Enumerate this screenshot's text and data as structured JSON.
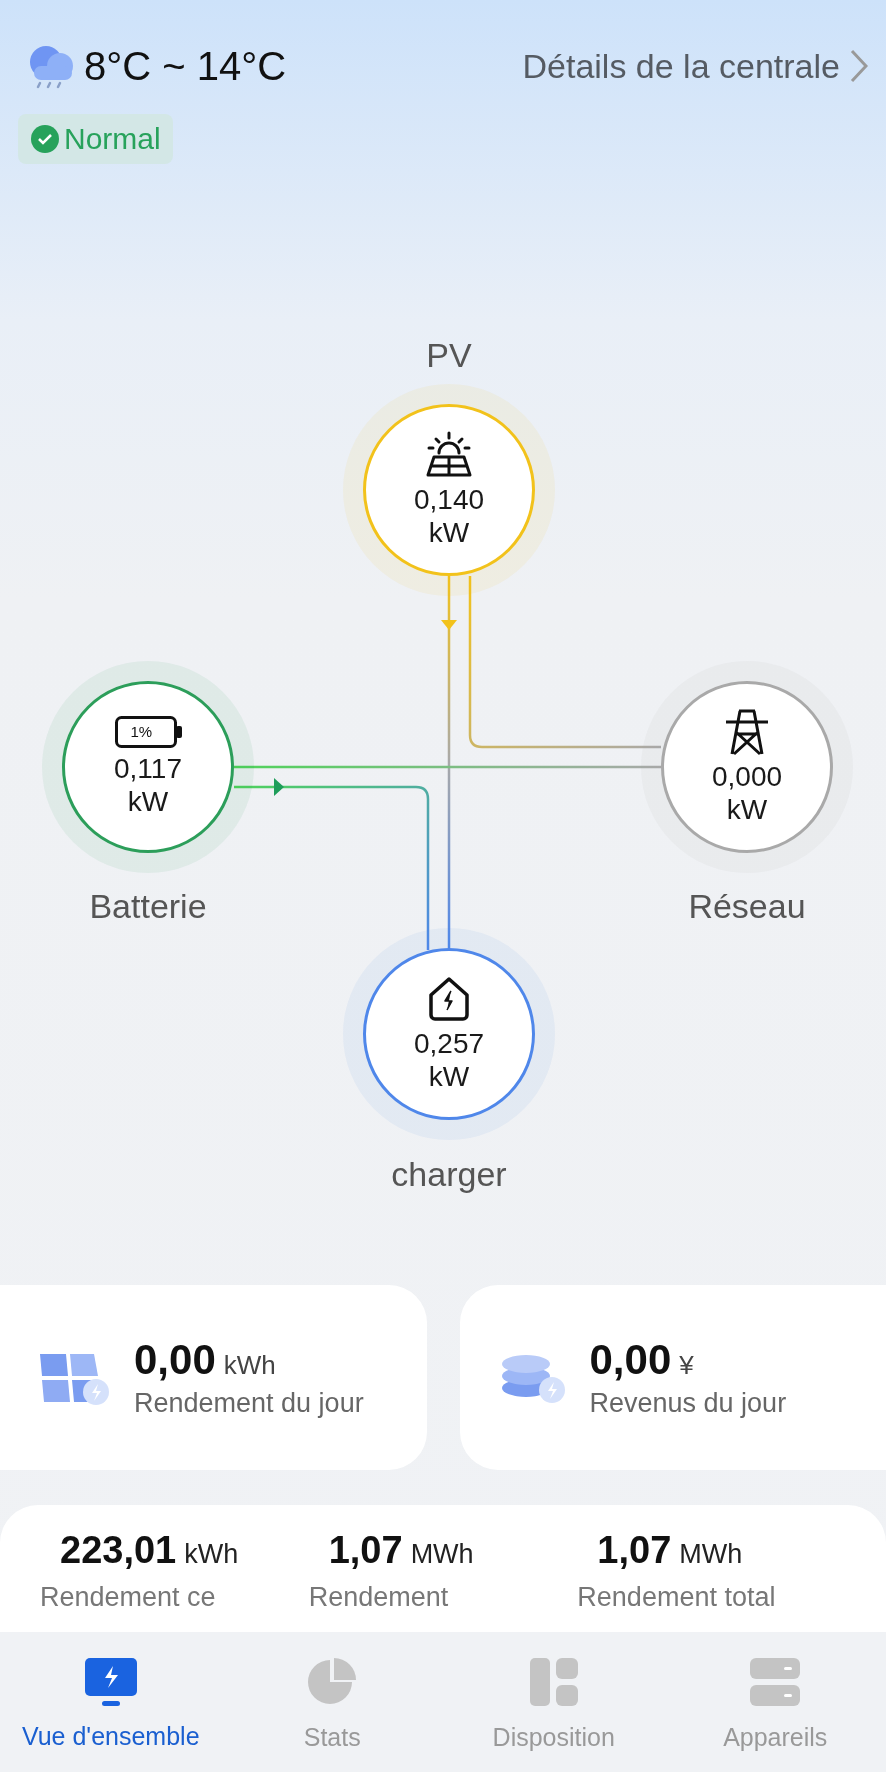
{
  "header": {
    "temperature": "8°C ~ 14°C",
    "details_link": "Détails de la centrale"
  },
  "status": {
    "label": "Normal",
    "ok": true
  },
  "flow_nodes": [
    {
      "kind": "pv",
      "label": "PV",
      "value": "0,140",
      "unit": "kW",
      "color": "#f2c21b"
    },
    {
      "kind": "battery",
      "label": "Batterie",
      "value": "0,117",
      "unit": "kW",
      "color": "#2c9e5a",
      "charge": "1%"
    },
    {
      "kind": "grid",
      "label": "Réseau",
      "value": "0,000",
      "unit": "kW",
      "color": "#a9a9a9"
    },
    {
      "kind": "charger",
      "label": "charger",
      "value": "0,257",
      "unit": "kW",
      "color": "#4f87ea"
    }
  ],
  "daily_cards": [
    {
      "kind": "yield",
      "value": "0,00",
      "unit": "kWh",
      "label": "Rendement du jour"
    },
    {
      "kind": "revenue",
      "value": "0,00",
      "unit": "¥",
      "label": "Revenus du jour"
    }
  ],
  "totals": [
    {
      "value": "223,01",
      "unit": "kWh",
      "label": "Rendement ce"
    },
    {
      "value": "1,07",
      "unit": "MWh",
      "label": "Rendement"
    },
    {
      "value": "1,07",
      "unit": "MWh",
      "label": "Rendement total"
    }
  ],
  "nav_tabs": [
    {
      "kind": "overview",
      "label": "Vue d'ensemble",
      "selected": true
    },
    {
      "kind": "stats",
      "label": "Stats",
      "selected": false
    },
    {
      "kind": "layout",
      "label": "Disposition",
      "selected": false
    },
    {
      "kind": "devices",
      "label": "Appareils",
      "selected": false
    }
  ]
}
